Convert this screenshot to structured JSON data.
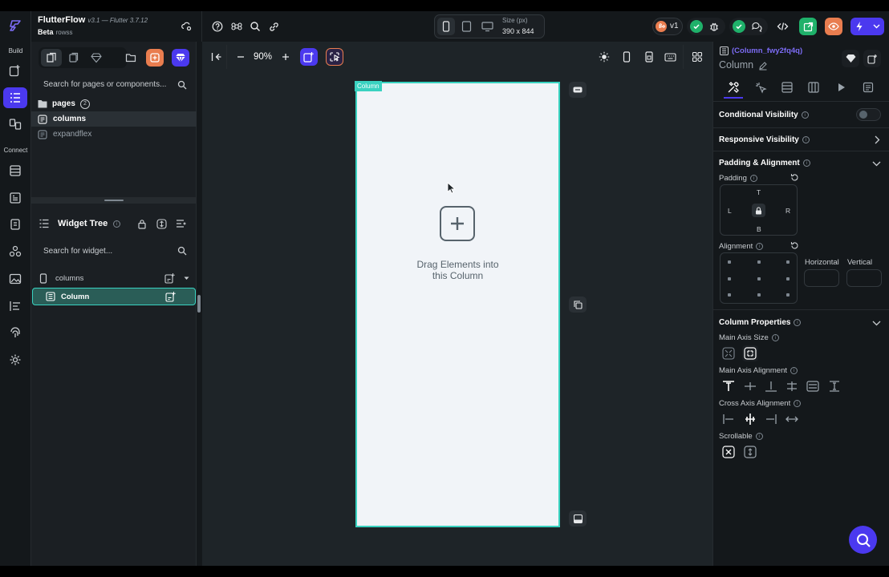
{
  "header": {
    "app_name": "FlutterFlow",
    "version": "v3.1 — Flutter 3.7.12",
    "beta": "Beta",
    "project": "rowss",
    "size_label": "Size (px)",
    "size_value": "390 x 844",
    "branch": "v1"
  },
  "rail": {
    "build_label": "Build",
    "connect_label": "Connect"
  },
  "left_panel": {
    "page_search_placeholder": "Search for pages or components...",
    "pages_label": "pages",
    "pages_count": "2",
    "pages": [
      "columns",
      "expandflex"
    ],
    "widget_tree_title": "Widget Tree",
    "widget_search_placeholder": "Search for widget...",
    "tree_root": "columns",
    "tree_selected": "Column"
  },
  "canvas": {
    "zoom": "90%",
    "column_tag": "Column",
    "drag_hint_line1": "Drag Elements into",
    "drag_hint_line2": "this Column"
  },
  "right_panel": {
    "widget_id": "(Column_fwy2fq4q)",
    "widget_name": "Column",
    "conditional_visibility": "Conditional Visibility",
    "responsive_visibility": "Responsive Visibility",
    "padding_alignment": "Padding & Alignment",
    "padding": "Padding",
    "pad_t": "T",
    "pad_l": "L",
    "pad_r": "R",
    "pad_b": "B",
    "alignment": "Alignment",
    "horizontal": "Horizontal",
    "vertical": "Vertical",
    "column_properties": "Column Properties",
    "main_axis_size": "Main Axis Size",
    "main_axis_alignment": "Main Axis Alignment",
    "cross_axis_alignment": "Cross Axis Alignment",
    "scrollable": "Scrollable"
  },
  "colors": {
    "accent": "#4b39ef",
    "teal": "#39d2c0",
    "orange": "#e97d4f",
    "green": "#1fb16a"
  }
}
